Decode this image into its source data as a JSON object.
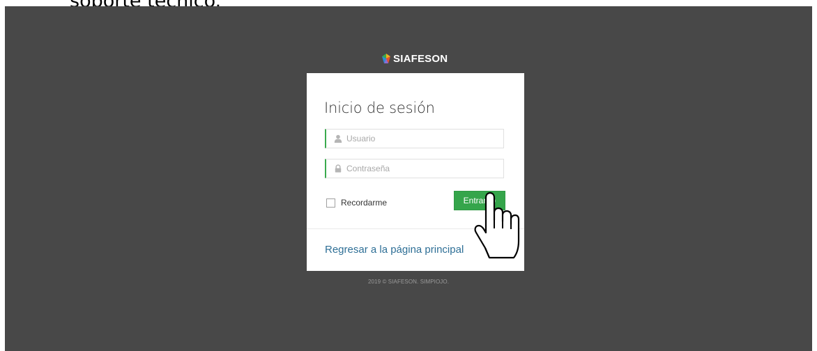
{
  "document": {
    "heading": "soporte técnico."
  },
  "brand": {
    "name": "SIAFESON",
    "colors": [
      "#f2b01e",
      "#3aaa4e",
      "#2c8ed6",
      "#e8512f"
    ]
  },
  "login": {
    "title": "Inicio de sesión",
    "username": {
      "placeholder": "Usuario",
      "icon": "user-icon",
      "value": ""
    },
    "password": {
      "placeholder": "Contraseña",
      "icon": "lock-icon",
      "value": ""
    },
    "remember_label": "Recordarme",
    "remember_checked": false,
    "submit_label": "Entrar",
    "submit_icon": "arrow-circle-right-icon",
    "back_link": "Regresar a la página principal"
  },
  "footer": {
    "text": "2019 © SIAFESON. SIMPIOJO."
  },
  "cursor": {
    "icon": "hand-pointer-cursor"
  },
  "colors": {
    "background": "#484848",
    "accent": "#35a54b",
    "link": "#2e6f96"
  }
}
